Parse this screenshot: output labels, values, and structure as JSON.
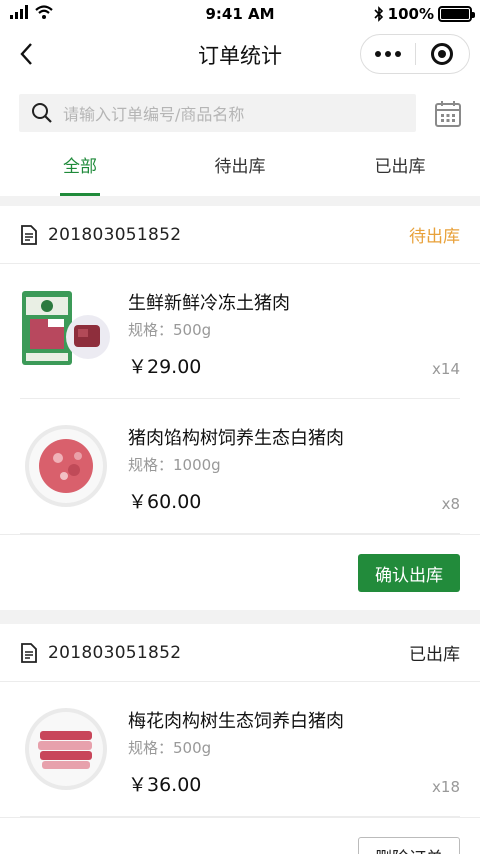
{
  "status_bar": {
    "time": "9:41 AM",
    "battery": "100%",
    "battery_level": 1.0
  },
  "nav": {
    "title": "订单统计"
  },
  "search": {
    "placeholder": "请输入订单编号/商品名称"
  },
  "tabs": [
    {
      "label": "全部",
      "active": true
    },
    {
      "label": "待出库",
      "active": false
    },
    {
      "label": "已出库",
      "active": false
    }
  ],
  "colors": {
    "accent": "#228b3b",
    "pending": "#e8a13a"
  },
  "orders": [
    {
      "order_no": "201803051852",
      "status": "待出库",
      "items": [
        {
          "name": "生鲜新鲜冷冻土猪肉",
          "spec": "规格：500g",
          "price": "￥29.00",
          "qty": "x14",
          "thumb": "pork-package"
        },
        {
          "name": "猪肉馅构树饲养生态白猪肉",
          "spec": "规格：1000g",
          "price": "￥60.00",
          "qty": "x8",
          "thumb": "minced-pork-plate"
        }
      ],
      "action": "确认出库"
    },
    {
      "order_no": "201803051852",
      "status": "已出库",
      "items": [
        {
          "name": "梅花肉构树生态饲养白猪肉",
          "spec": "规格：500g",
          "price": "￥36.00",
          "qty": "x18",
          "thumb": "pork-slices-plate"
        }
      ],
      "action": "删除订单"
    }
  ]
}
